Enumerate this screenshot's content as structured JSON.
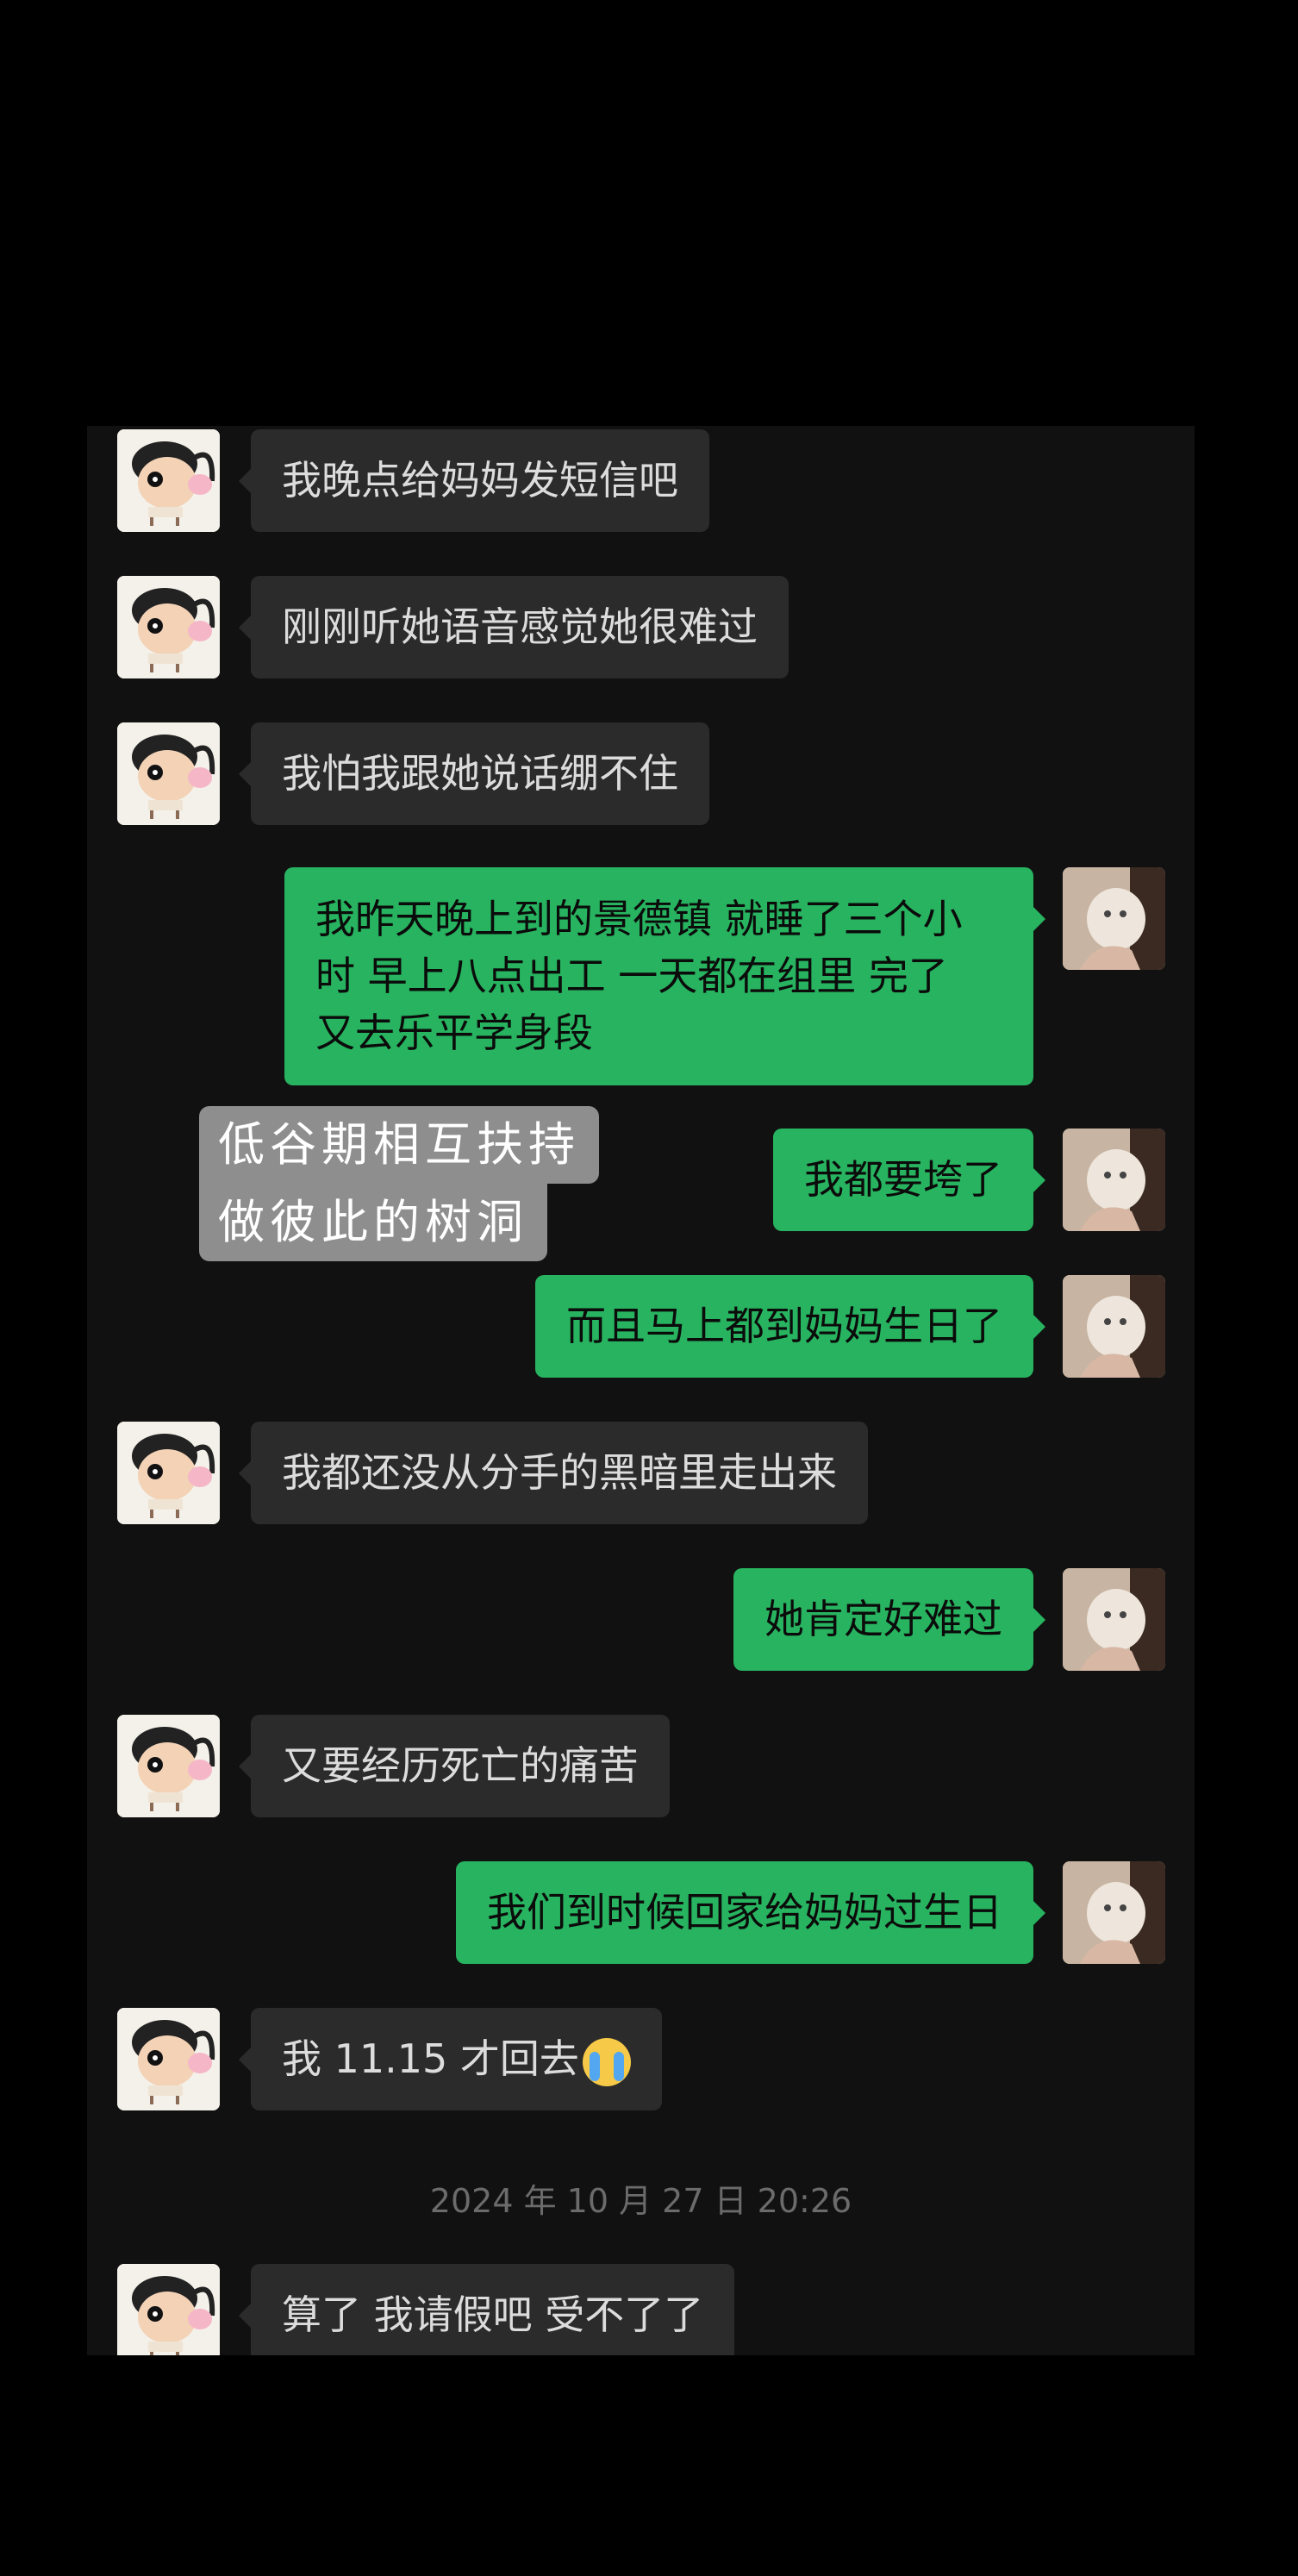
{
  "messages": [
    {
      "from": "them",
      "text": "我晚点给妈妈发短信吧"
    },
    {
      "from": "them",
      "text": "刚刚听她语音感觉她很难过"
    },
    {
      "from": "them",
      "text": "我怕我跟她说话绷不住"
    },
    {
      "from": "me",
      "lines": [
        "我昨天晚上到的景德镇 就睡了三个小",
        "时 早上八点出工 一天都在组里 完了",
        "又去乐平学身段"
      ]
    },
    {
      "from": "me",
      "text": "我都要垮了"
    },
    {
      "from": "me",
      "text": "而且马上都到妈妈生日了"
    },
    {
      "from": "them",
      "text": "我都还没从分手的黑暗里走出来"
    },
    {
      "from": "me",
      "text": "她肯定好难过"
    },
    {
      "from": "them",
      "text": "又要经历死亡的痛苦"
    },
    {
      "from": "me",
      "text": "我们到时候回家给妈妈过生日"
    },
    {
      "from": "them",
      "text": "我 11.15 才回去",
      "emoji": "crying-face"
    },
    {
      "from": "them",
      "text": "算了 我请假吧 受不了了"
    }
  ],
  "timestamp": "2024 年 10 月 27 日 20:26",
  "overlay_sticker": {
    "line1": "低谷期相互扶持",
    "line2": "做彼此的树洞"
  },
  "colors": {
    "sent_bubble": "#27b35f",
    "received_bubble": "#2b2b2b",
    "background": "#111111"
  }
}
